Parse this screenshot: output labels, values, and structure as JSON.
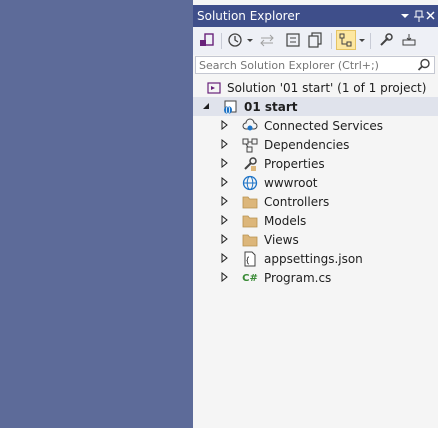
{
  "panel": {
    "title": "Solution Explorer",
    "title_icons": [
      "dropdown-icon",
      "pin-icon",
      "close-icon"
    ]
  },
  "toolbar": {
    "buttons": [
      "switch-views-icon",
      "history-icon",
      "sync-icon",
      "collapse-all-icon",
      "show-all-files-icon",
      "solution-view-icon",
      "properties-wrench-icon",
      "preview-icon"
    ]
  },
  "search": {
    "placeholder": "Search Solution Explorer (Ctrl+;)"
  },
  "tree": {
    "solution": {
      "label": "Solution '01 start' (1 of 1 project)",
      "icon": "solution-icon"
    },
    "project": {
      "label": "01 start",
      "icon": "web-project-icon",
      "expanded": true
    },
    "items": [
      {
        "label": "Connected Services",
        "icon": "connected-services-icon"
      },
      {
        "label": "Dependencies",
        "icon": "dependencies-icon"
      },
      {
        "label": "Properties",
        "icon": "properties-icon"
      },
      {
        "label": "wwwroot",
        "icon": "globe-icon"
      },
      {
        "label": "Controllers",
        "icon": "folder-icon"
      },
      {
        "label": "Models",
        "icon": "folder-icon"
      },
      {
        "label": "Views",
        "icon": "folder-icon"
      },
      {
        "label": "appsettings.json",
        "icon": "json-file-icon"
      },
      {
        "label": "Program.cs",
        "icon": "csharp-file-icon",
        "icon_text": "C#"
      }
    ]
  },
  "colors": {
    "background": "#5d6b99",
    "titlebar": "#3e4e8a",
    "panel": "#f5f5f5",
    "selected_row": "#e0e3ec",
    "folder": "#dcb67a",
    "csharp": "#388a34"
  }
}
